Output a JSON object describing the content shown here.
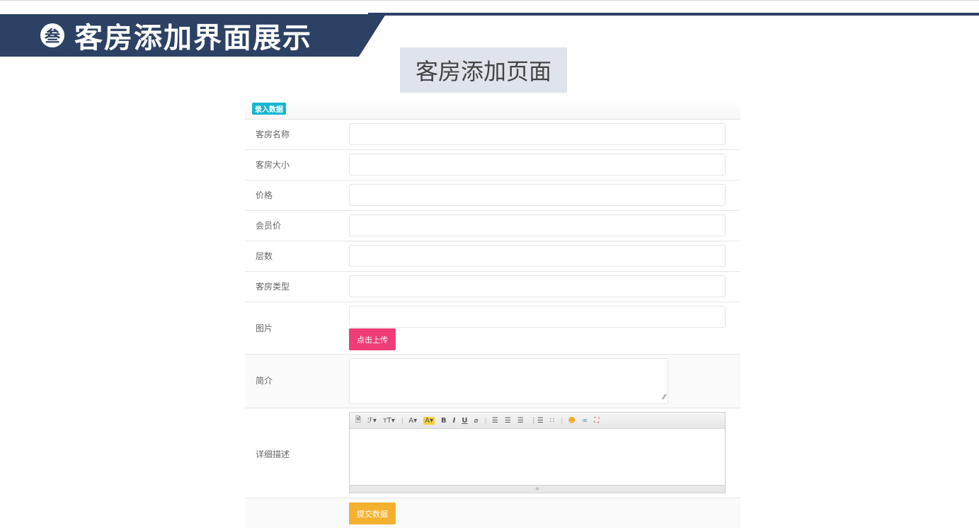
{
  "banner": {
    "icon_glyph": "叁",
    "title": "客房添加界面展示"
  },
  "subtitle": "客房添加页面",
  "form": {
    "badge": "录入数据",
    "fields": [
      {
        "label": "客房名称"
      },
      {
        "label": "客房大小"
      },
      {
        "label": "价格"
      },
      {
        "label": "会员价"
      },
      {
        "label": "层数"
      },
      {
        "label": "客房类型"
      }
    ],
    "image_label": "图片",
    "upload_button": "点击上传",
    "intro_label": "简介",
    "detail_label": "详细描述",
    "submit_button": "提交数据",
    "editor_toolbar": [
      "source-icon",
      "font-family-icon",
      "font-size-icon",
      "font-color-icon",
      "highlight-icon",
      "bold-icon",
      "italic-icon",
      "underline-icon",
      "clear-format-icon",
      "align-left-icon",
      "align-center-icon",
      "align-right-icon",
      "ordered-list-icon",
      "unordered-list-icon",
      "emoticon-icon",
      "link-icon",
      "fullscreen-icon"
    ]
  },
  "colors": {
    "banner": "#2c4164",
    "badge": "#1ab6cf",
    "upload": "#f03d78",
    "submit": "#f4b12f",
    "subtitle_bg": "#dfe3ec"
  }
}
